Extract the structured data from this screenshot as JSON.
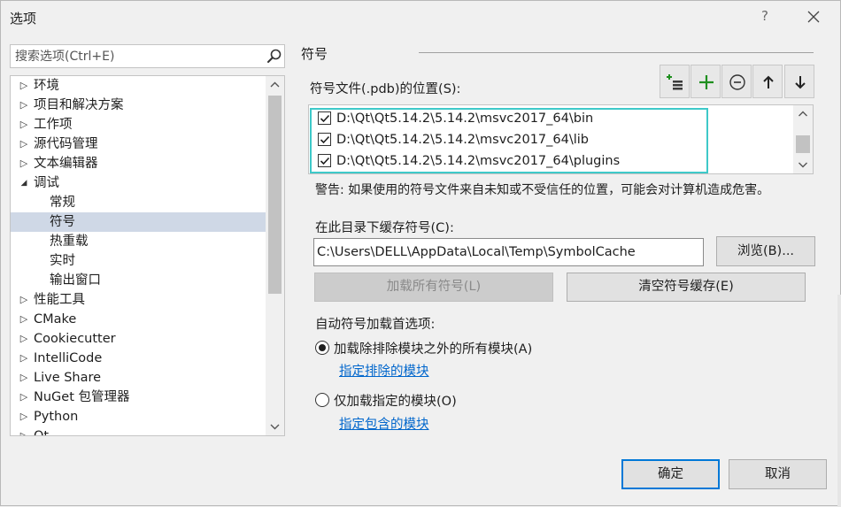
{
  "window": {
    "title": "选项",
    "help_label": "?"
  },
  "search": {
    "placeholder": "搜索选项(Ctrl+E)"
  },
  "tree": {
    "items": [
      {
        "label": "环境",
        "level": 0,
        "expanded": false
      },
      {
        "label": "项目和解决方案",
        "level": 0,
        "expanded": false
      },
      {
        "label": "工作项",
        "level": 0,
        "expanded": false
      },
      {
        "label": "源代码管理",
        "level": 0,
        "expanded": false
      },
      {
        "label": "文本编辑器",
        "level": 0,
        "expanded": false
      },
      {
        "label": "调试",
        "level": 0,
        "expanded": true
      },
      {
        "label": "常规",
        "level": 1
      },
      {
        "label": "符号",
        "level": 1,
        "selected": true
      },
      {
        "label": "热重载",
        "level": 1
      },
      {
        "label": "实时",
        "level": 1
      },
      {
        "label": "输出窗口",
        "level": 1
      },
      {
        "label": "性能工具",
        "level": 0,
        "expanded": false
      },
      {
        "label": "CMake",
        "level": 0,
        "expanded": false
      },
      {
        "label": "Cookiecutter",
        "level": 0,
        "expanded": false
      },
      {
        "label": "IntelliCode",
        "level": 0,
        "expanded": false
      },
      {
        "label": "Live Share",
        "level": 0,
        "expanded": false
      },
      {
        "label": "NuGet 包管理器",
        "level": 0,
        "expanded": false
      },
      {
        "label": "Python",
        "level": 0,
        "expanded": false
      },
      {
        "label": "Qt",
        "level": 0,
        "expanded": false
      }
    ]
  },
  "symbols": {
    "section_title": "符号",
    "locations_label": "符号文件(.pdb)的位置(S):",
    "paths": [
      {
        "text": "D:\\Qt\\Qt5.14.2\\5.14.2\\msvc2017_64\\bin",
        "checked": true
      },
      {
        "text": "D:\\Qt\\Qt5.14.2\\5.14.2\\msvc2017_64\\lib",
        "checked": true
      },
      {
        "text": "D:\\Qt\\Qt5.14.2\\5.14.2\\msvc2017_64\\plugins",
        "checked": true
      }
    ],
    "warning": "警告: 如果使用的符号文件来自未知或不受信任的位置，可能会对计算机造成危害。",
    "cache_label": "在此目录下缓存符号(C):",
    "cache_path": "C:\\Users\\DELL\\AppData\\Local\\Temp\\SymbolCache",
    "browse_label": "浏览(B)...",
    "load_all_label": "加载所有符号(L)",
    "clear_cache_label": "清空符号缓存(E)",
    "auto_label": "自动符号加载首选项:",
    "option_all_label": "加载除排除模块之外的所有模块(A)",
    "option_all_link": "指定排除的模块",
    "option_specified_label": "仅加载指定的模块(O)",
    "option_specified_link": "指定包含的模块",
    "selected_option": "all"
  },
  "footer": {
    "ok_label": "确定",
    "cancel_label": "取消"
  },
  "colors": {
    "accent": "#0078d7",
    "highlight": "#3ec9c9",
    "selection": "#cfd8e6",
    "link": "#0066cc",
    "add_icon": "#1e8f1e"
  }
}
